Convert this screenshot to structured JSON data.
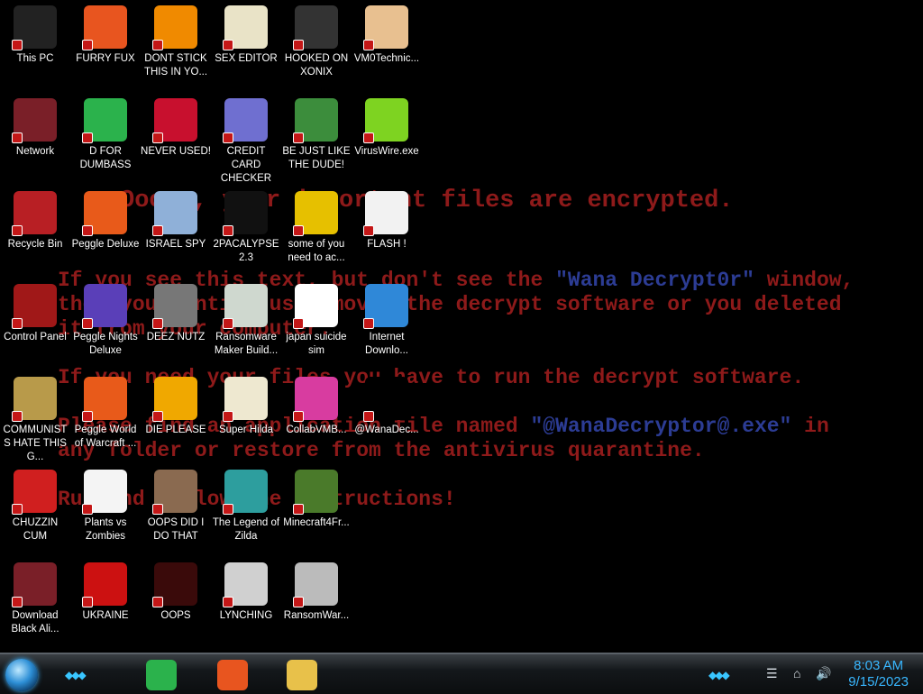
{
  "wallpaper": {
    "title": "Ooops, your important files are encrypted.",
    "line1a": "If you see this text, but don't see the ",
    "line1b": "\"Wana Decrypt0r\"",
    "line1c": " window,",
    "line2": "then your antivirus removed the decrypt software or you deleted",
    "line3": "it from your computer.",
    "line4": "If you need your files you have to run the decrypt software.",
    "line5a": "Please find an application file named ",
    "line5b": "\"@WanaDecryptor@.exe\"",
    "line5c": " in",
    "line6": "any folder or restore from the antivirus quarantine.",
    "line7": "Run and follow the instructions!"
  },
  "icons": [
    {
      "label": "This PC",
      "icon": "computer-icon",
      "color": "#222"
    },
    {
      "label": "FURRY FUX",
      "icon": "firefox-icon",
      "color": "#e8551f"
    },
    {
      "label": "DONT STICK THIS IN YO...",
      "icon": "vlc-cone-icon",
      "color": "#f08a00"
    },
    {
      "label": "SEX EDITOR",
      "icon": "hxd-hex-editor-icon",
      "color": "#e9e3c7"
    },
    {
      "label": "HOOKED ON XONIX",
      "icon": "xonix-game-icon",
      "color": "#333"
    },
    {
      "label": "VM0Technic...",
      "icon": "doctor-icon",
      "color": "#e8c090"
    },
    {
      "label": "Network",
      "icon": "network-orb-icon",
      "color": "#7a1f28"
    },
    {
      "label": "D FOR DUMBASS",
      "icon": "feedly-icon",
      "color": "#2bb24c"
    },
    {
      "label": "NEVER USED!",
      "icon": "dev-cpp-icon",
      "color": "#c8102e"
    },
    {
      "label": "CREDIT CARD CHECKER",
      "icon": "credit-card-icon",
      "color": "#6f6fd0"
    },
    {
      "label": "BE JUST LIKE THE DUDE!",
      "icon": "elf-icon",
      "color": "#3c8d3c"
    },
    {
      "label": "VirusWire.exe",
      "icon": "lime-wheel-icon",
      "color": "#7ed321"
    },
    {
      "label": "Recycle Bin",
      "icon": "recycle-bin-icon",
      "color": "#b81f24"
    },
    {
      "label": "Peggle Deluxe",
      "icon": "peggle-icon",
      "color": "#e85a1a"
    },
    {
      "label": "ISRAEL SPY",
      "icon": "spy-network-icon",
      "color": "#8fb0d8"
    },
    {
      "label": "2PACALYPSE 2.3",
      "icon": "terminal-icon",
      "color": "#111"
    },
    {
      "label": "some of you need to ac...",
      "icon": "dog-cartoon-icon",
      "color": "#e6c000"
    },
    {
      "label": "FLASH !",
      "icon": "flash-file-icon",
      "color": "#f2f2f2"
    },
    {
      "label": "Control Panel",
      "icon": "control-panel-icon",
      "color": "#a01818"
    },
    {
      "label": "Peggle Nights Deluxe",
      "icon": "peggle-nights-icon",
      "color": "#5a3fb8"
    },
    {
      "label": "DEEZ NUTZ",
      "icon": "stacked-windows-icon",
      "color": "#777"
    },
    {
      "label": "Ransomware Maker Build...",
      "icon": "app-window-icon",
      "color": "#cfd8cf"
    },
    {
      "label": "japan suicide sim",
      "icon": "document-icon",
      "color": "#ffffff"
    },
    {
      "label": "Internet Downlo...",
      "icon": "idm-globe-icon",
      "color": "#2f88d8"
    },
    {
      "label": "COMMUNISTS HATE THIS G...",
      "icon": "money-bag-icon",
      "color": "#b89a4a"
    },
    {
      "label": "Peggle World of Warcraft ...",
      "icon": "peggle-wow-icon",
      "color": "#e85a1a"
    },
    {
      "label": "DIE PLEASE",
      "icon": "de-letters-icon",
      "color": "#f0a800"
    },
    {
      "label": "Super Hilda",
      "icon": "pixel-character-icon",
      "color": "#eee8d0"
    },
    {
      "label": "CollabVMB...",
      "icon": "collabvm-icon",
      "color": "#d83ca0"
    },
    {
      "label": "@WanaDec...",
      "icon": "wana-decryptor-icon",
      "color": "#000"
    },
    {
      "label": "CHUZZIN CUM",
      "icon": "chuzzle-icon",
      "color": "#d01f1f"
    },
    {
      "label": "Plants vs Zombies",
      "icon": "flower-icon",
      "color": "#f4f4f4"
    },
    {
      "label": "OOPS DID I DO THAT",
      "icon": "portrait-icon",
      "color": "#8a6a50"
    },
    {
      "label": "The Legend of Zilda",
      "icon": "pixel-hero-icon",
      "color": "#2d9e9e"
    },
    {
      "label": "Minecraft4Fr...",
      "icon": "grass-block-icon",
      "color": "#4a7a2a"
    },
    {
      "label": "",
      "icon": "",
      "color": ""
    },
    {
      "label": "Download Black Ali...",
      "icon": "download-orb-icon",
      "color": "#7a1f28"
    },
    {
      "label": "UKRAINE",
      "icon": "radiation-icon",
      "color": "#cc1111"
    },
    {
      "label": "OOPS",
      "icon": "red-monitor-icon",
      "color": "#3a0a0a"
    },
    {
      "label": "LYNCHING",
      "icon": "noose-icon",
      "color": "#d0d0d0"
    },
    {
      "label": "RansomWar...",
      "icon": "skull-icon",
      "color": "#bbb"
    }
  ],
  "taskbar": {
    "pinned": [
      {
        "name": "feedly-icon",
        "color": "#2bb24c"
      },
      {
        "name": "firefox-icon",
        "color": "#e8551f"
      },
      {
        "name": "file-explorer-icon",
        "color": "#e8c14a"
      }
    ],
    "time": "8:03 AM",
    "date": "9/15/2023"
  }
}
